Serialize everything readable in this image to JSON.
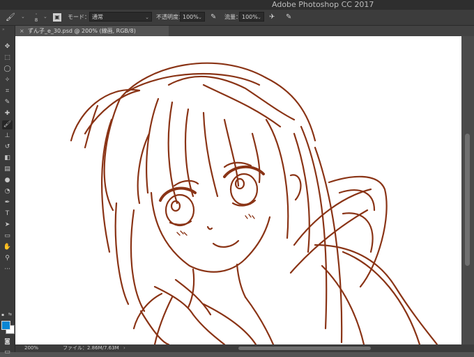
{
  "app": {
    "title": "Adobe Photoshop CC 2017"
  },
  "options": {
    "brush_size": "8",
    "mode_label": "モード：",
    "mode_value": "通常",
    "opacity_label": "不透明度：",
    "opacity_value": "100%",
    "flow_label": "流量：",
    "flow_value": "100%"
  },
  "document": {
    "tab_close": "×",
    "tab_title": "ずん子_e_30.psd @ 200% (線画, RGB/8)"
  },
  "status": {
    "zoom": "200%",
    "file_info": "ファイル：2.86M/7.63M",
    "chevron": "›"
  },
  "tools": [
    {
      "icon": "move-icon",
      "glyph": "✥"
    },
    {
      "icon": "marquee-icon",
      "glyph": "⬚"
    },
    {
      "icon": "lasso-icon",
      "glyph": "◯"
    },
    {
      "icon": "magic-wand-icon",
      "glyph": "✧"
    },
    {
      "icon": "crop-icon",
      "glyph": "⌗"
    },
    {
      "icon": "eyedropper-icon",
      "glyph": "✎"
    },
    {
      "icon": "healing-brush-icon",
      "glyph": "✚"
    },
    {
      "icon": "brush-icon",
      "glyph": "🖌"
    },
    {
      "icon": "clone-stamp-icon",
      "glyph": "⊥"
    },
    {
      "icon": "history-brush-icon",
      "glyph": "↺"
    },
    {
      "icon": "eraser-icon",
      "glyph": "◧"
    },
    {
      "icon": "gradient-icon",
      "glyph": "▤"
    },
    {
      "icon": "blur-icon",
      "glyph": "●"
    },
    {
      "icon": "dodge-icon",
      "glyph": "◔"
    },
    {
      "icon": "pen-icon",
      "glyph": "✒"
    },
    {
      "icon": "type-icon",
      "glyph": "T"
    },
    {
      "icon": "path-selection-icon",
      "glyph": "➤"
    },
    {
      "icon": "rectangle-icon",
      "glyph": "▭"
    },
    {
      "icon": "hand-icon",
      "glyph": "✋"
    },
    {
      "icon": "zoom-icon",
      "glyph": "⚲"
    },
    {
      "icon": "more-tools-icon",
      "glyph": "···"
    }
  ],
  "colors": {
    "foreground": "#0a86d4",
    "background": "#ffffff",
    "line_art": "#8a3416"
  }
}
